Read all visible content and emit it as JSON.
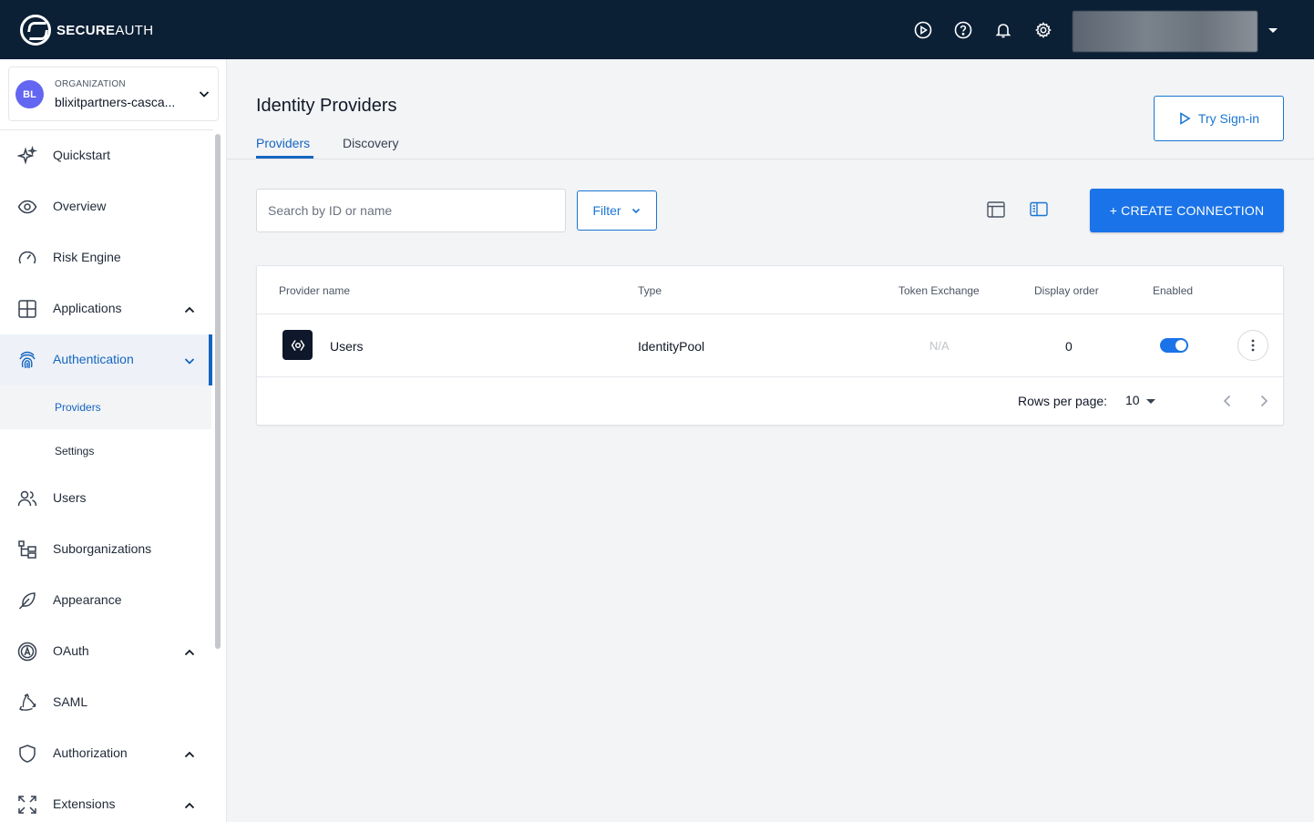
{
  "brand": {
    "bold": "SECURE",
    "light": "AUTH"
  },
  "topbar_icons": [
    "play-circle-icon",
    "help-icon",
    "bell-icon",
    "gear-icon"
  ],
  "org": {
    "initials": "BL",
    "label": "ORGANIZATION",
    "name": "blixitpartners-casca..."
  },
  "nav": {
    "items": [
      {
        "label": "Quickstart",
        "icon": "sparkles-icon"
      },
      {
        "label": "Overview",
        "icon": "eye-icon"
      },
      {
        "label": "Risk Engine",
        "icon": "gauge-icon"
      },
      {
        "label": "Applications",
        "icon": "grid-icon"
      },
      {
        "label": "Authentication",
        "icon": "fingerprint-icon"
      },
      {
        "label": "Users",
        "icon": "users-icon"
      },
      {
        "label": "Suborganizations",
        "icon": "hierarchy-icon"
      },
      {
        "label": "Appearance",
        "icon": "feather-icon"
      },
      {
        "label": "OAuth",
        "icon": "oauth-icon"
      },
      {
        "label": "SAML",
        "icon": "saml-icon"
      },
      {
        "label": "Authorization",
        "icon": "shield-icon"
      },
      {
        "label": "Extensions",
        "icon": "expand-icon"
      }
    ],
    "sub_items": [
      "Providers",
      "Settings"
    ]
  },
  "page": {
    "title": "Identity Providers",
    "tabs": [
      "Providers",
      "Discovery"
    ],
    "try_signin": "Try Sign-in",
    "search_placeholder": "Search by ID or name",
    "filter": "Filter",
    "create": "+ CREATE CONNECTION"
  },
  "table": {
    "columns": [
      "Provider name",
      "Type",
      "Token Exchange",
      "Display order",
      "Enabled"
    ],
    "rows": [
      {
        "name": "Users",
        "type": "IdentityPool",
        "token_exchange": "N/A",
        "display_order": "0",
        "enabled": true
      }
    ],
    "rows_per_page_label": "Rows per page:",
    "rows_per_page": "10"
  },
  "colors": {
    "topbar": "#0b1f35",
    "accent": "#1a73e8",
    "active_text": "#1565c0"
  }
}
